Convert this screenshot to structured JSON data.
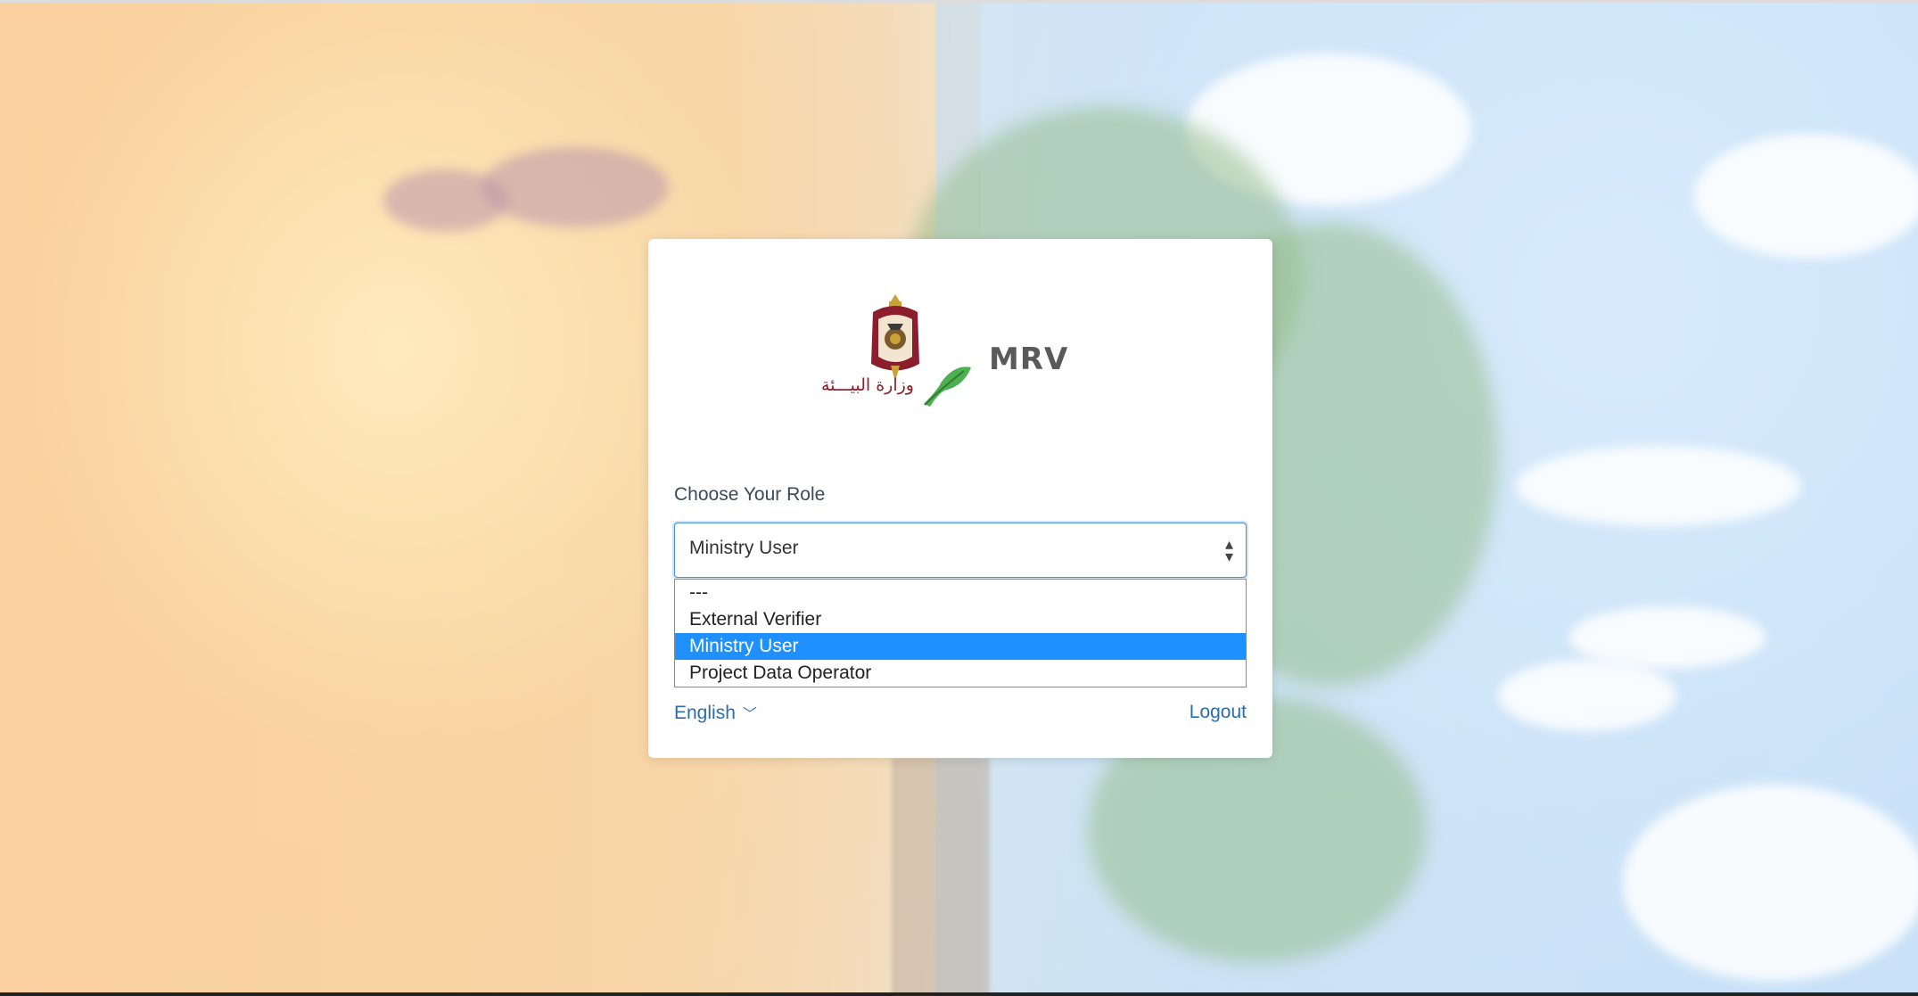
{
  "brand": {
    "app_name": "MRV",
    "ministry_arabic": "وزارة البيـــئة",
    "colors": {
      "accent": "#2b6cb0",
      "selected": "#1e90ff",
      "logo_text": "#8a1f2a"
    }
  },
  "role_form": {
    "label": "Choose Your Role",
    "selected_value": "Ministry User",
    "options": [
      {
        "label": "---",
        "selected": false
      },
      {
        "label": "External Verifier",
        "selected": false
      },
      {
        "label": "Ministry User",
        "selected": true
      },
      {
        "label": "Project Data Operator",
        "selected": false
      }
    ]
  },
  "footer": {
    "language": "English",
    "logout": "Logout"
  },
  "icons": {
    "select_arrow": "sort-arrows-icon",
    "language_chevron": "chevron-down-icon"
  }
}
